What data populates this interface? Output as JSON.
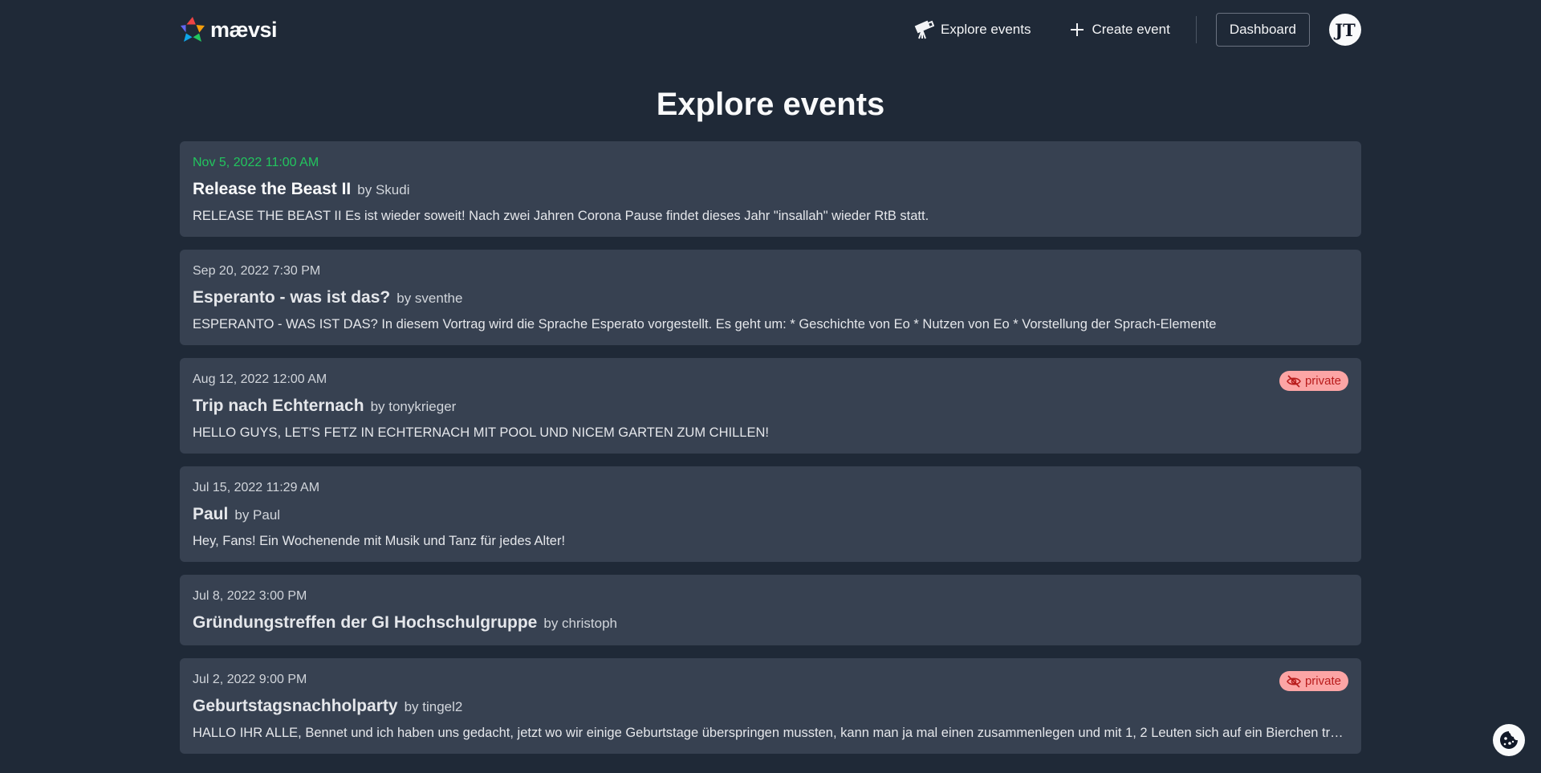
{
  "header": {
    "logo_text": "mævsi",
    "nav": {
      "explore_label": "Explore events",
      "create_label": "Create event",
      "dashboard_label": "Dashboard"
    },
    "avatar_initials": "JT"
  },
  "page_title": "Explore events",
  "events": [
    {
      "date": "Nov 5, 2022 11:00 AM",
      "name": "Release the Beast II",
      "author": "by Skudi",
      "description": "RELEASE THE BEAST II Es ist wieder soweit! Nach zwei Jahren Corona Pause findet dieses Jahr \"insallah\" wieder RtB statt.",
      "private": false,
      "upcoming": true
    },
    {
      "date": "Sep 20, 2022 7:30 PM",
      "name": "Esperanto - was ist das?",
      "author": "by sventhe",
      "description": "ESPERANTO - WAS IST DAS? In diesem Vortrag wird die Sprache Esperato vorgestellt. Es geht um: * Geschichte von Eo * Nutzen von Eo * Vorstellung der Sprach-Elemente",
      "private": false,
      "upcoming": false
    },
    {
      "date": "Aug 12, 2022 12:00 AM",
      "name": "Trip nach Echternach",
      "author": "by tonykrieger",
      "description": "HELLO GUYS, LET'S FETZ IN ECHTERNACH MIT POOL UND NICEM GARTEN ZUM CHILLEN!",
      "private": true,
      "private_label": "private",
      "upcoming": false
    },
    {
      "date": "Jul 15, 2022 11:29 AM",
      "name": "Paul",
      "author": "by Paul",
      "description": "Hey, Fans! Ein Wochenende mit Musik und Tanz für jedes Alter!",
      "private": false,
      "upcoming": false
    },
    {
      "date": "Jul 8, 2022 3:00 PM",
      "name": "Gründungstreffen der GI Hochschulgruppe",
      "author": "by christoph",
      "description": "",
      "private": false,
      "upcoming": false
    },
    {
      "date": "Jul 2, 2022 9:00 PM",
      "name": "Geburtstagsnachholparty",
      "author": "by tingel2",
      "description": "HALLO IHR ALLE, Bennet und ich haben uns gedacht, jetzt wo wir einige Geburtstage überspringen mussten, kann man ja mal einen zusammenlegen und mit 1, 2 Leuten sich auf ein Bierchen treffen.",
      "private": true,
      "private_label": "private",
      "upcoming": false
    }
  ],
  "colors": {
    "background": "#1f2937",
    "card": "#374151",
    "upcoming_date": "#22c55e",
    "private_badge_bg": "#fca5a5",
    "private_badge_text": "#b91c1c"
  }
}
